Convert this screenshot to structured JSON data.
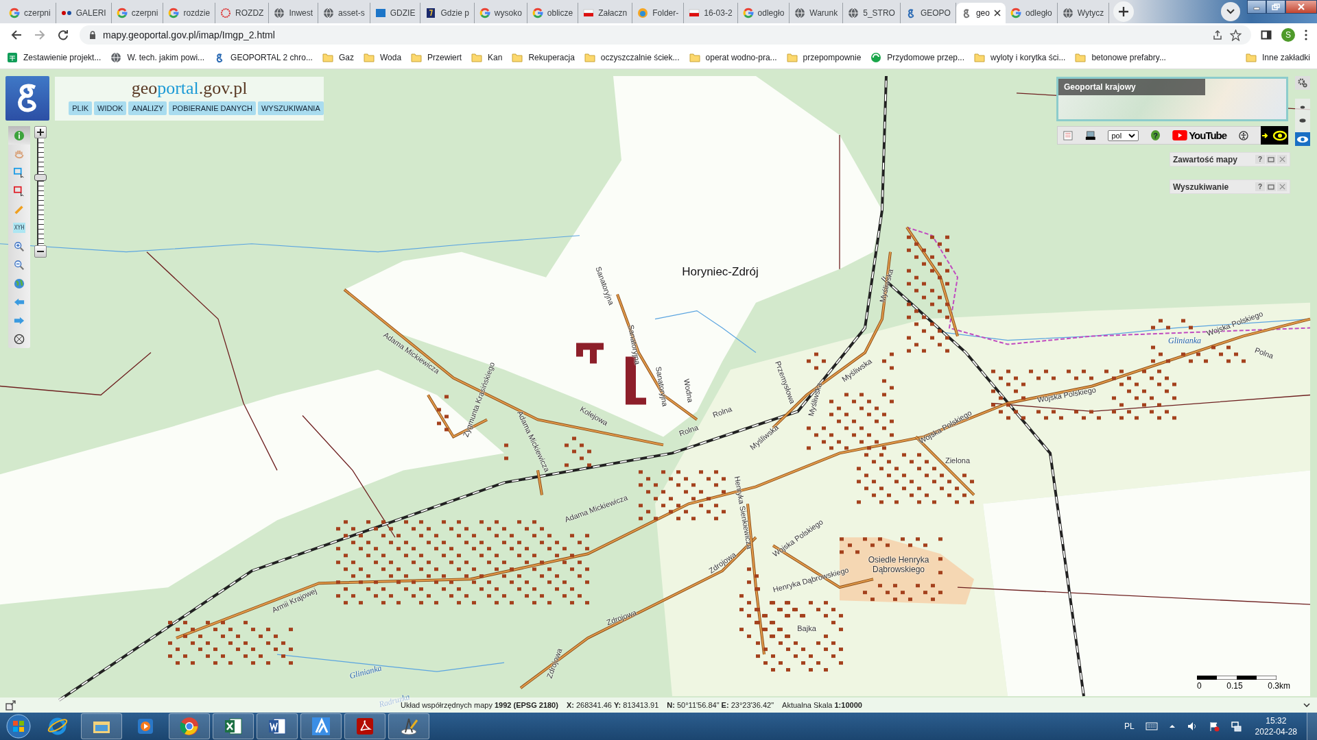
{
  "browser": {
    "tabs": [
      {
        "title": "czerpni",
        "kind": "google",
        "selected": false
      },
      {
        "title": "GALERI",
        "kind": "dots",
        "selected": false
      },
      {
        "title": "czerpni",
        "kind": "google",
        "selected": false
      },
      {
        "title": "rozdzie",
        "kind": "google",
        "selected": false
      },
      {
        "title": "ROZDZ",
        "kind": "swirl",
        "selected": false
      },
      {
        "title": "Inwest",
        "kind": "globe",
        "selected": false
      },
      {
        "title": "asset-s",
        "kind": "globe",
        "selected": false
      },
      {
        "title": "GDZIE",
        "kind": "ve",
        "selected": false
      },
      {
        "title": "Gdzie p",
        "kind": "book",
        "selected": false
      },
      {
        "title": "wysoko",
        "kind": "google",
        "selected": false
      },
      {
        "title": "oblicze",
        "kind": "google",
        "selected": false
      },
      {
        "title": "Załaczn",
        "kind": "flag",
        "selected": false
      },
      {
        "title": "Folder-",
        "kind": "drop",
        "selected": false
      },
      {
        "title": "16-03-2",
        "kind": "flag",
        "selected": false
      },
      {
        "title": "odległo",
        "kind": "google",
        "selected": false
      },
      {
        "title": "Warunk",
        "kind": "globe",
        "selected": false
      },
      {
        "title": "5_STRO",
        "kind": "globe",
        "selected": false
      },
      {
        "title": "GEOPO",
        "kind": "gletter",
        "selected": false
      },
      {
        "title": "geo",
        "kind": "gletter",
        "selected": true
      },
      {
        "title": "odległo",
        "kind": "google",
        "selected": false
      },
      {
        "title": "Wytycz",
        "kind": "globe",
        "selected": false
      }
    ],
    "url": "mapy.geoportal.gov.pl/imap/Imgp_2.html",
    "avatar": "S",
    "bookmarks": [
      {
        "title": "Zestawienie projekt...",
        "kind": "sheet"
      },
      {
        "title": "W. tech. jakim powi...",
        "kind": "globe"
      },
      {
        "title": "GEOPORTAL 2 chro...",
        "kind": "gletter"
      },
      {
        "title": "Gaz",
        "kind": "folder"
      },
      {
        "title": "Woda",
        "kind": "folder"
      },
      {
        "title": "Przewiert",
        "kind": "folder"
      },
      {
        "title": "Kan",
        "kind": "folder"
      },
      {
        "title": "Rekuperacja",
        "kind": "folder"
      },
      {
        "title": "oczyszczalnie ściek...",
        "kind": "folder"
      },
      {
        "title": "operat wodno-pra...",
        "kind": "folder"
      },
      {
        "title": "przepompownie",
        "kind": "folder"
      },
      {
        "title": "Przydomowe przep...",
        "kind": "recycle"
      },
      {
        "title": "wyloty i korytka ści...",
        "kind": "folder"
      },
      {
        "title": "betonowe prefabry...",
        "kind": "folder"
      }
    ],
    "other_bookmarks": "Inne zakładki"
  },
  "geoportal": {
    "logo_parts": [
      {
        "text": "geo",
        "kind": "dark"
      },
      {
        "text": "portal",
        "kind": "accent"
      },
      {
        "text": ".gov.pl",
        "kind": "dark"
      }
    ],
    "menu": [
      "PLIK",
      "WIDOK",
      "ANALIZY",
      "POBIERANIE DANYCH",
      "WYSZUKIWANIA"
    ],
    "tools": [
      {
        "kind": "info",
        "selected": true
      },
      {
        "kind": "hand",
        "selected": false
      },
      {
        "kind": "select",
        "selected": false
      },
      {
        "kind": "deselect",
        "selected": false
      },
      {
        "kind": "pencil",
        "selected": false
      },
      {
        "kind": "xyh",
        "label": "XYH",
        "selected": false
      },
      {
        "kind": "zoom-in",
        "selected": false
      },
      {
        "kind": "zoom-out",
        "selected": false
      },
      {
        "kind": "globe",
        "selected": false
      },
      {
        "kind": "back",
        "selected": false
      },
      {
        "kind": "forward",
        "selected": false
      },
      {
        "kind": "crosshair",
        "selected": false
      }
    ],
    "zoom": {
      "level": 0.65
    },
    "overview_title": "Geoportal krajowy",
    "language": "pol",
    "help": "?",
    "youtube": "YouTube",
    "panels": [
      {
        "title": "Zawartość mapy"
      },
      {
        "title": "Wyszukiwanie"
      }
    ],
    "map_labels": [
      {
        "text": "Horyniec-Zdrój",
        "kind": "place"
      },
      {
        "text": "Adama Mickiewicza",
        "kind": "street"
      },
      {
        "text": "Zygmunta Krasińskiego",
        "kind": "street"
      },
      {
        "text": "Adama Mickiewicza",
        "kind": "street"
      },
      {
        "text": "Kolejowa",
        "kind": "street"
      },
      {
        "text": "Sanatoryjna",
        "kind": "street"
      },
      {
        "text": "Sanatoryjna",
        "kind": "street"
      },
      {
        "text": "Sanatoryjna",
        "kind": "street"
      },
      {
        "text": "Wodna",
        "kind": "street"
      },
      {
        "text": "Rolna",
        "kind": "street"
      },
      {
        "text": "Rolna",
        "kind": "street"
      },
      {
        "text": "Przemysłowa",
        "kind": "street"
      },
      {
        "text": "Myśliwska",
        "kind": "street"
      },
      {
        "text": "Myśliwska",
        "kind": "street"
      },
      {
        "text": "Myśliwska",
        "kind": "street"
      },
      {
        "text": "Myśliwska",
        "kind": "street"
      },
      {
        "text": "Wojska Polskiego",
        "kind": "street"
      },
      {
        "text": "Wojska Polskiego",
        "kind": "street"
      },
      {
        "text": "Wojska Polskiego",
        "kind": "street"
      },
      {
        "text": "Wojska Polskiego",
        "kind": "street"
      },
      {
        "text": "Polna",
        "kind": "street"
      },
      {
        "text": "Glinianka",
        "kind": "water"
      },
      {
        "text": "Zielona",
        "kind": "street"
      },
      {
        "text": "Adama Mickiewicza",
        "kind": "street"
      },
      {
        "text": "Zdrojowa",
        "kind": "street"
      },
      {
        "text": "Zdrojowa",
        "kind": "street"
      },
      {
        "text": "Zdrojowa",
        "kind": "street"
      },
      {
        "text": "Armii Krajowej",
        "kind": "street"
      },
      {
        "text": "Henryka Dąbrowskiego",
        "kind": "street"
      },
      {
        "text": "Henryka Sienkiewicza",
        "kind": "street"
      },
      {
        "text": "Osiedle Henryka Dąbrowskiego",
        "kind": "estate"
      },
      {
        "text": "Bajka",
        "kind": "street"
      },
      {
        "text": "Glinianka",
        "kind": "water"
      },
      {
        "text": "Radruzka",
        "kind": "water"
      }
    ],
    "scale_ticks": [
      "0",
      "0.15",
      "0.3km"
    ],
    "status": [
      "Układ współrzędnych mapy **1992 (EPSG 2180)**",
      "**X:** 268341.46 **Y:** 813413.91",
      "**N:** 50°11'56.84\" **E:** 23°23'36.42\"",
      "Aktualna Skala **1:10000**"
    ]
  },
  "taskbar": {
    "apps": [
      {
        "kind": "ie",
        "running": false
      },
      {
        "kind": "explorer",
        "running": true
      },
      {
        "kind": "media",
        "running": false
      },
      {
        "kind": "chrome",
        "running": true
      },
      {
        "kind": "excel",
        "running": true
      },
      {
        "kind": "word",
        "running": true
      },
      {
        "kind": "cad",
        "running": true
      },
      {
        "kind": "pdf",
        "running": true
      },
      {
        "kind": "compass",
        "running": true
      }
    ],
    "language": "PL",
    "time": "15:32",
    "date": "2022-04-28"
  }
}
